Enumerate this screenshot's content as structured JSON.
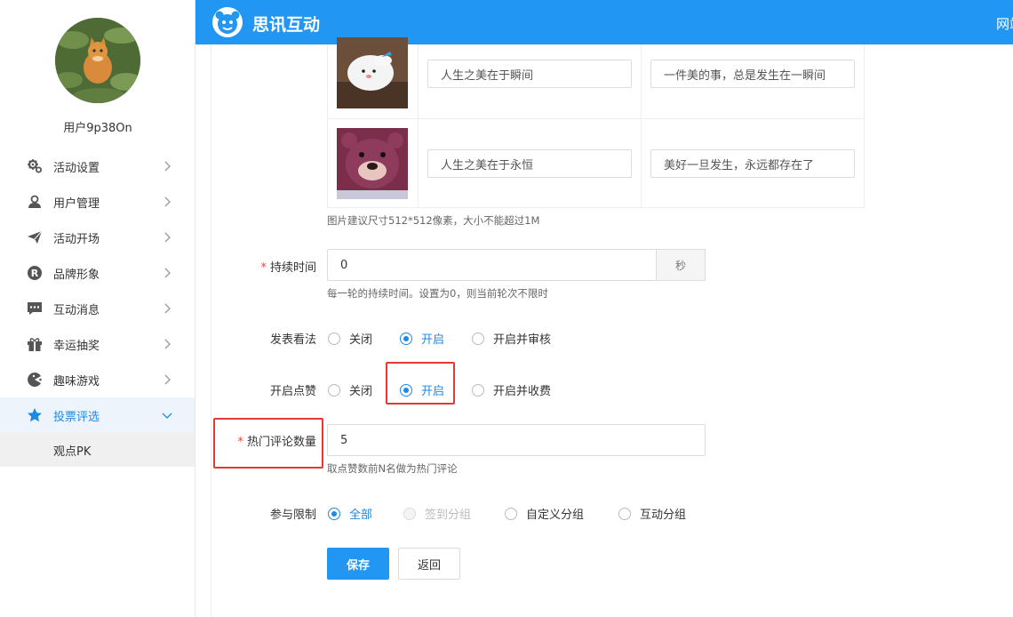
{
  "sidebar": {
    "username": "用户9p38On",
    "menu": [
      {
        "label": "活动设置",
        "icon": "gears-icon"
      },
      {
        "label": "用户管理",
        "icon": "user-card-icon"
      },
      {
        "label": "活动开场",
        "icon": "paper-plane-icon"
      },
      {
        "label": "品牌形象",
        "icon": "registered-icon"
      },
      {
        "label": "互动消息",
        "icon": "chat-bubble-icon"
      },
      {
        "label": "幸运抽奖",
        "icon": "gift-icon"
      },
      {
        "label": "趣味游戏",
        "icon": "pacman-icon"
      },
      {
        "label": "投票评选",
        "icon": "star-icon"
      }
    ],
    "submenu": [
      "观点PK"
    ]
  },
  "topbar": {
    "title": "思讯互动",
    "right_text": "网站"
  },
  "table": {
    "rows": [
      {
        "col1": "人生之美在于瞬间",
        "col2": "一件美的事，总是发生在一瞬间"
      },
      {
        "col1": "人生之美在于永恒",
        "col2": "美好一旦发生，永远都存在了"
      }
    ],
    "image_hint": "图片建议尺寸512*512像素，大小不能超过1M"
  },
  "form": {
    "duration": {
      "label": "持续时间",
      "value": "0",
      "unit": "秒",
      "hint": "每一轮的持续时间。设置为0，则当前轮次不限时"
    },
    "post_opinion": {
      "label": "发表看法",
      "options": [
        "关闭",
        "开启",
        "开启并审核"
      ],
      "selected": 1
    },
    "enable_like": {
      "label": "开启点赞",
      "options": [
        "关闭",
        "开启",
        "开启并收费"
      ],
      "selected": 1
    },
    "hot_comments": {
      "label": "热门评论数量",
      "value": "5",
      "hint": "取点赞数前N名做为热门评论"
    },
    "participation": {
      "label": "参与限制",
      "options": [
        "全部",
        "签到分组",
        "自定义分组",
        "互动分组"
      ],
      "selected": 0
    }
  },
  "buttons": {
    "save": "保存",
    "back": "返回"
  },
  "colors": {
    "primary": "#2196f3",
    "highlight": "#e53935"
  }
}
